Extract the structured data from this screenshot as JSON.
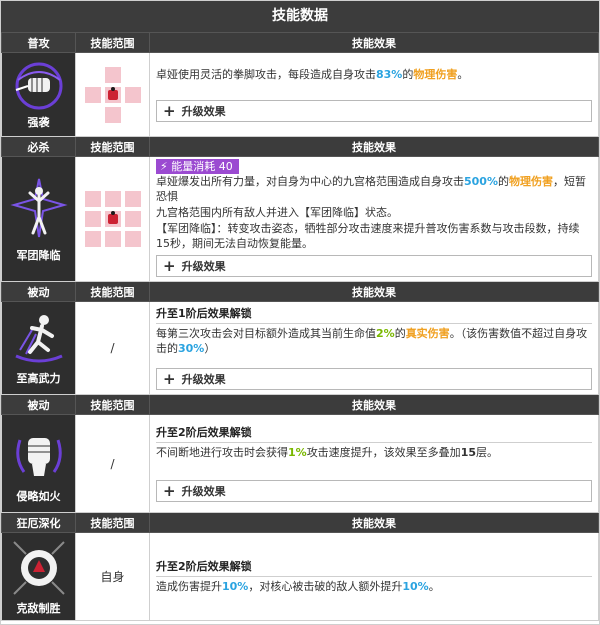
{
  "page_title": "技能数据",
  "header_range": "技能范围",
  "header_effect": "技能效果",
  "upgrade_label": "升级效果",
  "skills": [
    {
      "type": "普攻",
      "name": "强袭",
      "desc": [
        "卓娅使用灵活的拳脚攻击，每段造成自身攻击",
        "83%",
        "的",
        "物理伤害",
        "。"
      ]
    },
    {
      "type": "必杀",
      "name": "军团降临",
      "energy": "能量消耗 40",
      "desc_a": [
        "卓娅爆发出所有力量，对自身为中心的九宫格范围造成自身攻击",
        "500%",
        "的",
        "物理伤害",
        "，短暂恐惧"
      ],
      "desc_b": "九宫格范围内所有敌人并进入【军团降临】状态。",
      "desc_c": "【军团降临】：转变攻击姿态，牺牲部分攻击速度来提升普攻伤害系数与攻击段数，持续15秒，期间无法自动恢复能量。"
    },
    {
      "type": "被动",
      "name": "至高武力",
      "range": "/",
      "unlock": "升至1阶后效果解锁",
      "desc": [
        "每第三次攻击会对目标额外造成其当前生命值",
        "2%",
        "的",
        "真实伤害",
        "。（该伤害数值不超过自身攻击的",
        "30%",
        "）"
      ]
    },
    {
      "type": "被动",
      "name": "侵略如火",
      "range": "/",
      "unlock": "升至2阶后效果解锁",
      "desc": [
        "不间断地进行攻击时会获得",
        "1%",
        "攻击速度提升，该效果至多叠加",
        "15",
        "层。"
      ]
    },
    {
      "type": "狂厄深化",
      "name": "克敌制胜",
      "range": "自身",
      "unlock": "升至2阶后效果解锁",
      "desc": [
        "造成伤害提升",
        "10%",
        "，对核心被击破的敌人额外提升",
        "10%",
        "。"
      ]
    }
  ],
  "colors": {
    "header_bg": "#3c3c3c",
    "icon_bg": "#2e2e2e",
    "range_cell": "#f4c5cd",
    "center_cell": "#cc2233",
    "blue": "#2aa3e0",
    "orange": "#f0a020",
    "green": "#7ab800",
    "energy_bg": "#9b4ad1"
  }
}
